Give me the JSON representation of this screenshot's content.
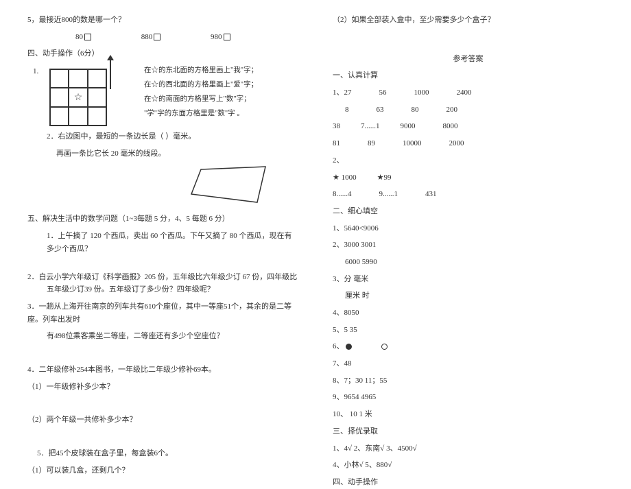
{
  "left": {
    "q5": "5，最接近800的数是哪一个？",
    "opt_a": "80",
    "opt_b": "880",
    "opt_c": "980",
    "sec4_title": "四、动手操作（6分）",
    "sec4_1": "1.",
    "grid_line1": "在☆的东北面的方格里画上\"我\"字；",
    "grid_line2": "在☆的西北面的方格里画上\"爱\"字；",
    "grid_line3": "在☆的南面的方格里写上\"数\"字；",
    "grid_line4": "\"学\"字的东面方格里是\"数\"字 。",
    "sec4_2a": "2．右边图中，最短的一条边长是（      ）毫米。",
    "sec4_2b": "再画一条比它长 20 毫米的线段。",
    "sec5_title": "五、解决生活中的数学问题（1~3每题 5 分，4、5 每题 6 分）",
    "sec5_1": "1．上午摘了 120 个西瓜，卖出 60 个西瓜。下午又摘了 80 个西瓜，现在有多少个西瓜？",
    "sec5_2": "2．白云小学六年级订《科学画报》205 份，五年级比六年级少订 67 份，四年级比五年级少订39 份。五年级订了多少份？四年级呢？",
    "sec5_3a": "3．一趟从上海开往南京的列车共有610个座位，其中一等座51个，其余的是二等座。列车出发时",
    "sec5_3b": "有498位乘客乘坐二等座，二等座还有多少个空座位？",
    "sec5_4": "4．二年级修补254本图书，一年级比二年级少修补69本。",
    "sec5_4_1": "（1）一年级修补多少本？",
    "sec5_4_2": "（2）两个年级一共修补多少本？",
    "sec5_5": "5．把45个皮球装在盒子里，每盒装6个。",
    "sec5_5_1": "（1）可以装几盒，还剩几个？"
  },
  "right": {
    "q2": "（2）如果全部装入盒中，至少需要多少个盒子？",
    "ans_title": "参考答案",
    "s1": "一、认真计算",
    "r1a": "1、27",
    "r1b": "56",
    "r1c": "1000",
    "r1d": "2400",
    "r2a": "8",
    "r2b": "63",
    "r2c": "80",
    "r2d": "200",
    "r3a": "38",
    "r3b": "7......1",
    "r3c": "9000",
    "r3d": "8000",
    "r4a": "81",
    "r4b": "89",
    "r4c": "10000",
    "r4d": "2000",
    "s2": "2、",
    "star1": "★  1000",
    "star2": "★99",
    "r7": "8......4",
    "r7b": "9......1",
    "r7c": "431",
    "s2_title": "二、细心填空",
    "a1": "1、5640<9006",
    "a2": "2、3000     3001",
    "a2b": "6000     5990",
    "a3": "3、分     毫米",
    "a3b": "厘米     时",
    "a4": "4、8050",
    "a5": "5、5    35",
    "a6": "6、",
    "a7": "7、48",
    "a8": "8、7；30      11；55",
    "a9": "9、9654     4965",
    "a10": "10、 10       1        米",
    "s3_title": "三、择优录取",
    "c1": "1、4√    2、东南√    3、4500√",
    "c2": "4、小林√    5、880√",
    "s4_title": "四、动手操作"
  }
}
